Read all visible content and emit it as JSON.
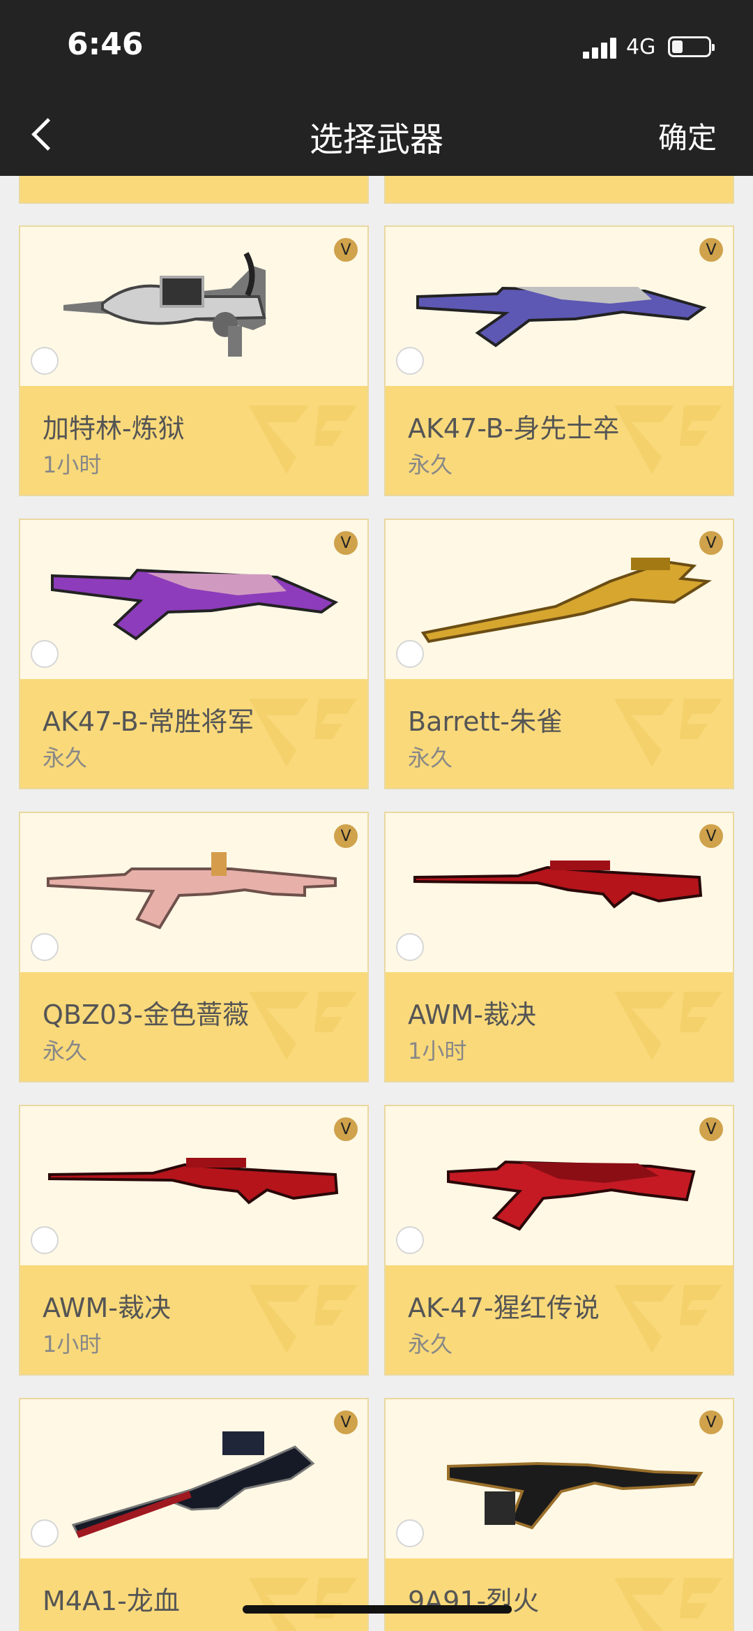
{
  "status": {
    "time": "6:46",
    "network": "4G"
  },
  "nav": {
    "title": "选择武器",
    "confirm": "确定"
  },
  "weapons": [
    {
      "name": "加特林-炼狱",
      "duration": "1小时",
      "palette": "silver"
    },
    {
      "name": "AK47-B-身先士卒",
      "duration": "永久",
      "palette": "blue"
    },
    {
      "name": "AK47-B-常胜将军",
      "duration": "永久",
      "palette": "purple"
    },
    {
      "name": "Barrett-朱雀",
      "duration": "永久",
      "palette": "gold"
    },
    {
      "name": "QBZ03-金色蔷薇",
      "duration": "永久",
      "palette": "pink"
    },
    {
      "name": "AWM-裁决",
      "duration": "1小时",
      "palette": "red"
    },
    {
      "name": "AWM-裁决",
      "duration": "1小时",
      "palette": "red"
    },
    {
      "name": "AK-47-猩红传说",
      "duration": "永久",
      "palette": "crimson"
    },
    {
      "name": "M4A1-龙血",
      "duration": "",
      "palette": "dark"
    },
    {
      "name": "9A91-烈火",
      "duration": "",
      "palette": "black"
    }
  ],
  "icons": {
    "back": "back-chevron-icon",
    "vip": "vip-badge-icon",
    "watermark": "cf-logo-watermark-icon"
  }
}
